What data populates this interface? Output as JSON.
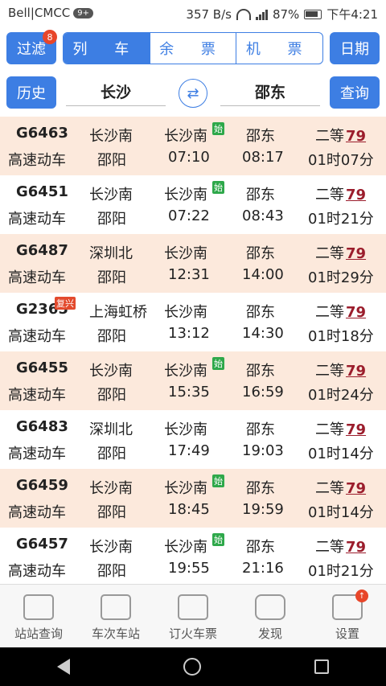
{
  "status_bar": {
    "carrier": "Bell|CMCC",
    "notification_count": "9+",
    "speed": "357 B/s",
    "battery": "87%",
    "time": "下午4:21"
  },
  "toolbar": {
    "filter_label": "过滤",
    "filter_badge": "8",
    "tabs": [
      "列 车",
      "余 票",
      "机 票"
    ],
    "date_label": "日期",
    "history_label": "历史",
    "from_city": "长沙",
    "to_city": "邵东",
    "swap_icon": "⇄",
    "search_label": "查询"
  },
  "trains": [
    {
      "no": "G6463",
      "type": "高速动车",
      "from": "长沙南",
      "from_city": "邵阳",
      "dep_station": "长沙南",
      "dep_time": "07:10",
      "arr_station": "邵东",
      "arr_time": "08:17",
      "seat": "二等",
      "price": "79",
      "duration": "01时07分",
      "badge": "始"
    },
    {
      "no": "G6451",
      "type": "高速动车",
      "from": "长沙南",
      "from_city": "邵阳",
      "dep_station": "长沙南",
      "dep_time": "07:22",
      "arr_station": "邵东",
      "arr_time": "08:43",
      "seat": "二等",
      "price": "79",
      "duration": "01时21分",
      "badge": "始"
    },
    {
      "no": "G6487",
      "type": "高速动车",
      "from": "深圳北",
      "from_city": "邵阳",
      "dep_station": "长沙南",
      "dep_time": "12:31",
      "arr_station": "邵东",
      "arr_time": "14:00",
      "seat": "二等",
      "price": "79",
      "duration": "01时29分",
      "badge": ""
    },
    {
      "no": "G2365",
      "type": "高速动车",
      "from": "上海虹桥",
      "from_city": "邵阳",
      "dep_station": "长沙南",
      "dep_time": "13:12",
      "arr_station": "邵东",
      "arr_time": "14:30",
      "seat": "二等",
      "price": "79",
      "duration": "01时18分",
      "badge": "",
      "tag": "复兴"
    },
    {
      "no": "G6455",
      "type": "高速动车",
      "from": "长沙南",
      "from_city": "邵阳",
      "dep_station": "长沙南",
      "dep_time": "15:35",
      "arr_station": "邵东",
      "arr_time": "16:59",
      "seat": "二等",
      "price": "79",
      "duration": "01时24分",
      "badge": "始"
    },
    {
      "no": "G6483",
      "type": "高速动车",
      "from": "深圳北",
      "from_city": "邵阳",
      "dep_station": "长沙南",
      "dep_time": "17:49",
      "arr_station": "邵东",
      "arr_time": "19:03",
      "seat": "二等",
      "price": "79",
      "duration": "01时14分",
      "badge": ""
    },
    {
      "no": "G6459",
      "type": "高速动车",
      "from": "长沙南",
      "from_city": "邵阳",
      "dep_station": "长沙南",
      "dep_time": "18:45",
      "arr_station": "邵东",
      "arr_time": "19:59",
      "seat": "二等",
      "price": "79",
      "duration": "01时14分",
      "badge": "始"
    },
    {
      "no": "G6457",
      "type": "高速动车",
      "from": "长沙南",
      "from_city": "邵阳",
      "dep_station": "长沙南",
      "dep_time": "19:55",
      "arr_station": "邵东",
      "arr_time": "21:16",
      "seat": "二等",
      "price": "79",
      "duration": "01时21分",
      "badge": "始"
    }
  ],
  "bottom_nav": {
    "items": [
      "站站查询",
      "车次车站",
      "订火车票",
      "发现",
      "设置"
    ],
    "settings_badge": "↑"
  },
  "colors": {
    "accent": "#3d7ee3",
    "row_tint": "#fce9dc",
    "price": "#9b1d2c",
    "start_badge": "#2ea84a"
  }
}
